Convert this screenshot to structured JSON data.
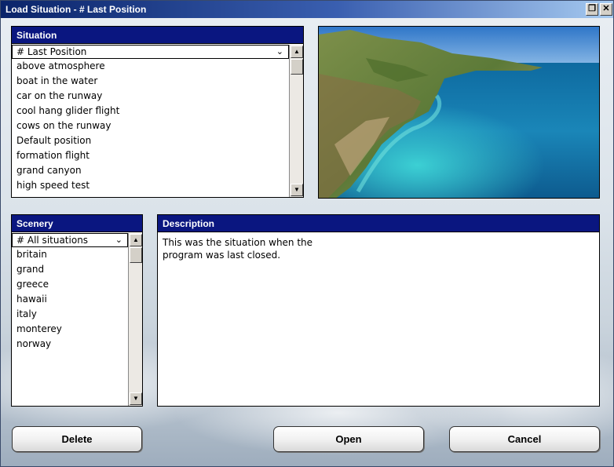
{
  "window": {
    "title": "Load Situation - # Last Position",
    "restore_glyph": "❐",
    "close_glyph": "✕"
  },
  "situation": {
    "header": "Situation",
    "selected": "# Last Position",
    "items": [
      "above atmosphere",
      "boat in the water",
      "car on the runway",
      "cool hang glider flight",
      "cows on the runway",
      "Default position",
      "formation flight",
      "grand canyon",
      "high speed test"
    ]
  },
  "scenery": {
    "header": "Scenery",
    "selected": "# All situations",
    "items": [
      "britain",
      "grand",
      "greece",
      "hawaii",
      "italy",
      "monterey",
      "norway"
    ]
  },
  "description": {
    "header": "Description",
    "text": "This was the situation when the\nprogram was last closed."
  },
  "buttons": {
    "delete": "Delete",
    "open": "Open",
    "cancel": "Cancel"
  },
  "icons": {
    "chevron": "⌄",
    "scroll_up": "▲",
    "scroll_down": "▼"
  },
  "colors": {
    "header_bg": "#0a1680",
    "title_start": "#0a246a",
    "sea": "#1a7fb0"
  }
}
